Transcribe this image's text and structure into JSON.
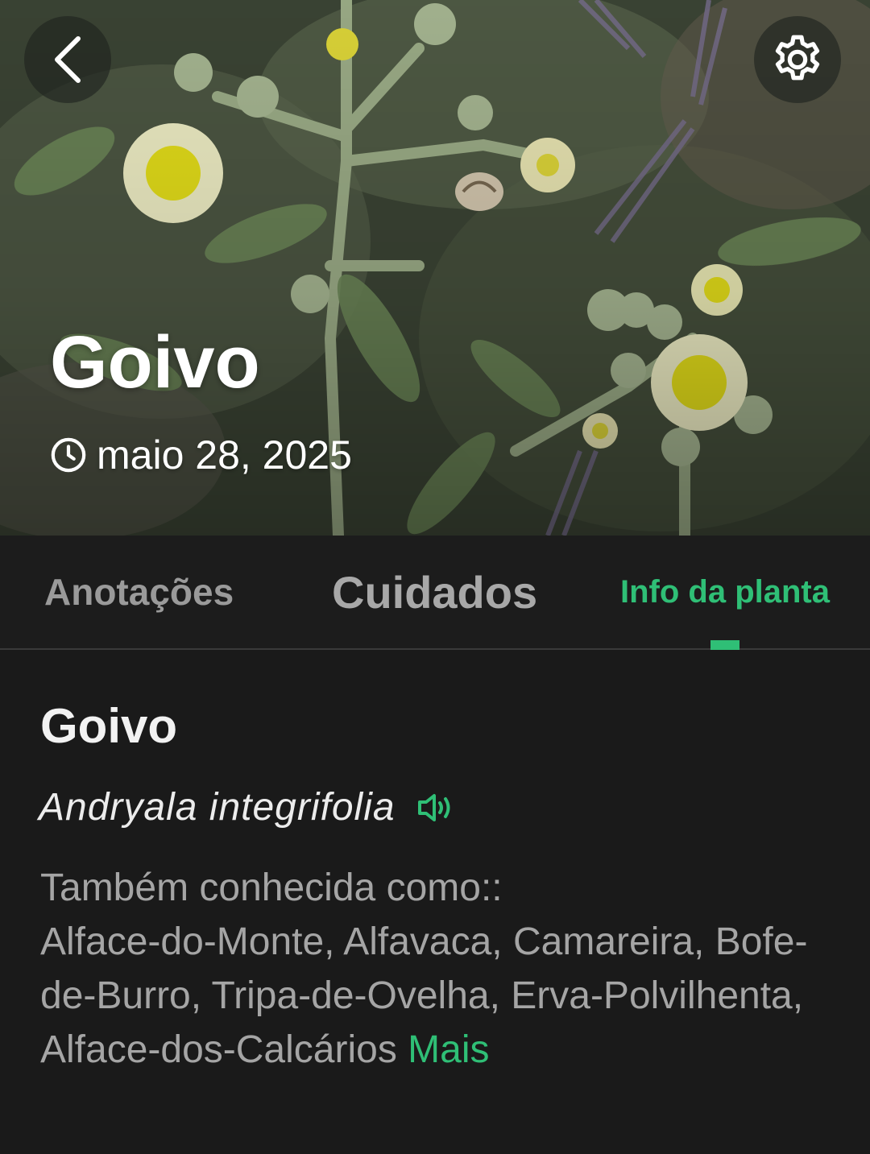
{
  "header": {
    "back_icon": "chevron-left-icon",
    "settings_icon": "gear-icon",
    "title": "Goivo",
    "date_icon": "clock-icon",
    "date": "maio 28, 2025"
  },
  "tabs": [
    {
      "label": "Anotações",
      "active": false
    },
    {
      "label": "Cuidados",
      "active": false
    },
    {
      "label": "Info da planta",
      "active": true
    }
  ],
  "plant": {
    "common_name": "Goivo",
    "scientific_name": "Andryala integrifolia",
    "speaker_icon": "speaker-icon",
    "aka_label": "Também conhecida como::",
    "aka_names": "Alface-do-Monte, Alfavaca, Camareira, Bofe-de-Burro, Tripa-de-Ovelha, Erva-Polvilhenta, Alface-dos-Calcários",
    "more_label": "Mais"
  },
  "colors": {
    "accent": "#2fbf76",
    "background": "#1a1a1a",
    "muted_text": "#a5a5a5"
  }
}
